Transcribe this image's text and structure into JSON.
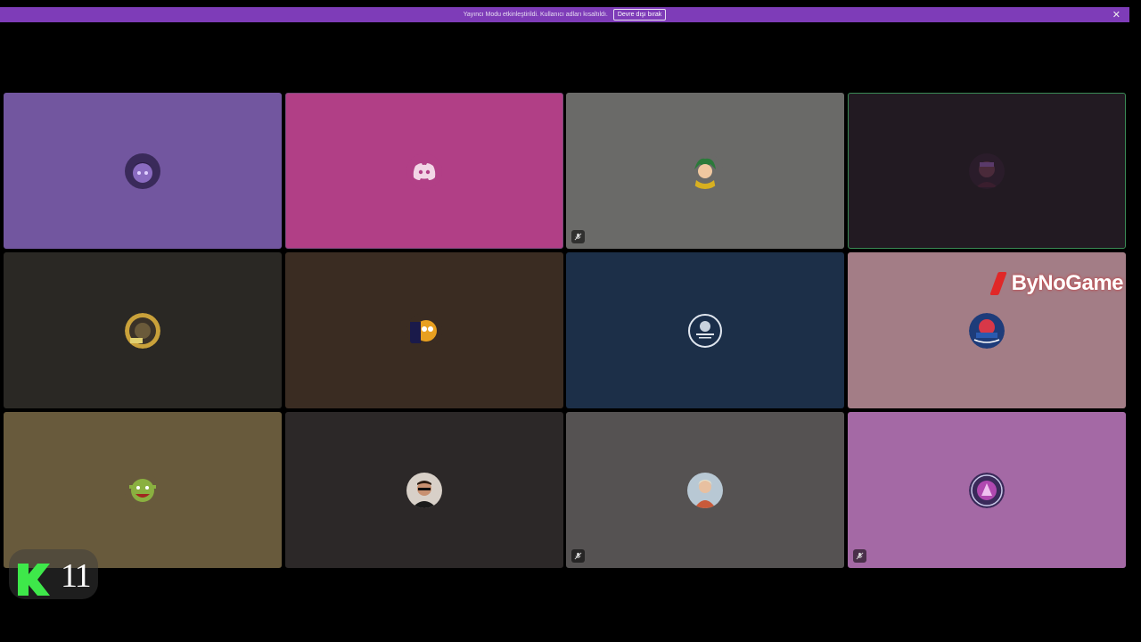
{
  "banner": {
    "message": "Yayıncı Modu etkinleştirildi. Kullanıcı adları kısaltıldı.",
    "button_label": "Devre dışı bırak",
    "close_glyph": "✕",
    "color": "#7e3cb8"
  },
  "tiles": [
    {
      "color": "#72569f",
      "avatar": "anime-purple-avatar",
      "muted": false,
      "state": "normal"
    },
    {
      "color": "#b13f86",
      "avatar": "discord-logo-avatar",
      "muted": false,
      "state": "active"
    },
    {
      "color": "#6a6a68",
      "avatar": "green-hair-anime-avatar",
      "muted": true,
      "state": "normal"
    },
    {
      "color": "#221a22",
      "avatar": "dark-character-avatar",
      "muted": false,
      "state": "speaking"
    },
    {
      "color": "#2a2824",
      "avatar": "gold-emblem-avatar",
      "muted": false,
      "state": "normal"
    },
    {
      "color": "#3a2c22",
      "avatar": "jake-dog-avatar",
      "muted": false,
      "state": "normal"
    },
    {
      "color": "#1c2f48",
      "avatar": "subaru-logo-avatar",
      "muted": false,
      "state": "normal"
    },
    {
      "color": "#a37d86",
      "avatar": "red-blue-team-logo-avatar",
      "muted": false,
      "state": "normal"
    },
    {
      "color": "#685a3c",
      "avatar": "shrek-avatar",
      "muted": false,
      "state": "normal"
    },
    {
      "color": "#2c2828",
      "avatar": "man-sunglasses-avatar",
      "muted": false,
      "state": "normal"
    },
    {
      "color": "#555252",
      "avatar": "person-portrait-avatar",
      "muted": true,
      "state": "normal"
    },
    {
      "color": "#a469a5",
      "avatar": "purple-emblem-avatar",
      "muted": true,
      "state": "normal"
    }
  ],
  "watermark": {
    "text": "ByNoGame"
  },
  "channel": {
    "number": "11",
    "accent": "#3ee84a"
  }
}
